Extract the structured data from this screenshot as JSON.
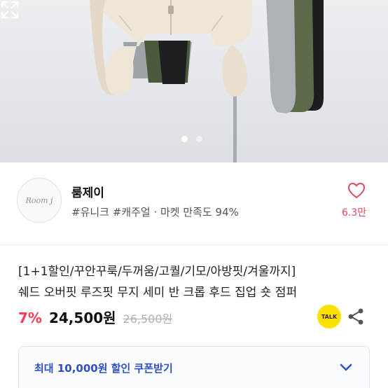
{
  "gallery": {
    "dots": [
      true,
      false
    ],
    "colors": {
      "background": "#e6e8ec",
      "cream_jacket": "#efe6d8",
      "gray_jacket": "#a9adb1",
      "khaki_jacket": "#5e6b4a",
      "black_jacket": "#1d1d1f",
      "rack": "#9ea3a8"
    }
  },
  "shop": {
    "logo_text": "Room j",
    "name": "룸제이",
    "tags": "#유니크 #캐주얼 · 마켓 만족도 94%",
    "like_count": "6.3만"
  },
  "product": {
    "title_line1": "[1+1할인/꾸안꾸룩/두꺼움/고퀄/기모/아방핏/겨울까지]",
    "title_line2": "쉐드 오버핏 루즈핏 무지 세미 반 크롭 후드 집업 숏 점퍼",
    "discount": "7%",
    "price": "24,500원",
    "original_price": "26,500원",
    "talk_label": "TALK"
  },
  "coupon": {
    "label": "최대 10,000원 할인 쿠폰받기"
  },
  "colors": {
    "accent_red": "#ff3b54",
    "like_red": "#e2495c",
    "coupon_blue": "#2f4fc8",
    "kakao_yellow": "#fae100"
  }
}
